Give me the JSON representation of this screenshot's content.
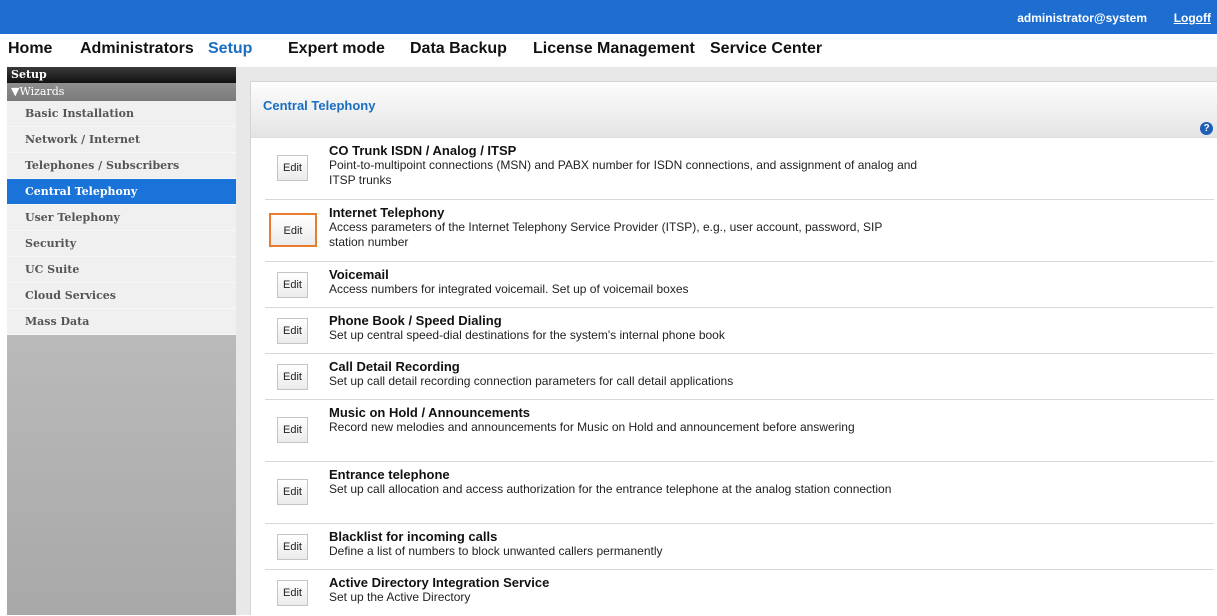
{
  "topbar": {
    "user": "administrator@system",
    "logoff": "Logoff"
  },
  "nav": [
    "Home",
    "Administrators",
    "Setup",
    "Expert mode",
    "Data Backup",
    "License Management",
    "Service Center"
  ],
  "nav_active": "Setup",
  "sidebar": {
    "title": "Setup",
    "group": "Wizards",
    "items": [
      "Basic Installation",
      "Network / Internet",
      "Telephones / Subscribers",
      "Central Telephony",
      "User Telephony",
      "Security",
      "UC Suite",
      "Cloud Services",
      "Mass Data"
    ],
    "active": "Central Telephony"
  },
  "panel": {
    "title": "Central Telephony",
    "help": "?",
    "rows": [
      {
        "button": "Edit",
        "title": "CO Trunk ISDN / Analog / ITSP",
        "desc": "Point-to-multipoint connections (MSN) and PABX number for ISDN connections, and assignment of analog and ITSP trunks"
      },
      {
        "button": "Edit",
        "title": "Internet Telephony",
        "desc": "Access parameters of the Internet Telephony Service Provider (ITSP), e.g., user account, password, SIP station number",
        "highlighted": true
      },
      {
        "button": "Edit",
        "title": "Voicemail",
        "desc": "Access numbers for integrated voicemail. Set up of voicemail boxes"
      },
      {
        "button": "Edit",
        "title": "Phone Book / Speed Dialing",
        "desc": "Set up central speed-dial destinations for the system's internal phone book"
      },
      {
        "button": "Edit",
        "title": "Call Detail Recording",
        "desc": "Set up call detail recording connection parameters for call detail applications"
      },
      {
        "button": "Edit",
        "title": "Music on Hold / Announcements",
        "desc": "Record new melodies and announcements for Music on Hold and announcement before answering"
      },
      {
        "button": "Edit",
        "title": "Entrance telephone",
        "desc": "Set up call allocation and access authorization for the entrance telephone at the analog station connection"
      },
      {
        "button": "Edit",
        "title": "Blacklist for incoming calls",
        "desc": "Define a list of numbers to block unwanted callers permanently"
      },
      {
        "button": "Edit",
        "title": "Active Directory Integration Service",
        "desc": "Set up the Active Directory"
      }
    ]
  },
  "colors": {
    "topbar": "#1d6ed0",
    "accent": "#1a6ec2",
    "sidebar_active": "#1a73d9",
    "highlight_border": "#e87d2f"
  }
}
